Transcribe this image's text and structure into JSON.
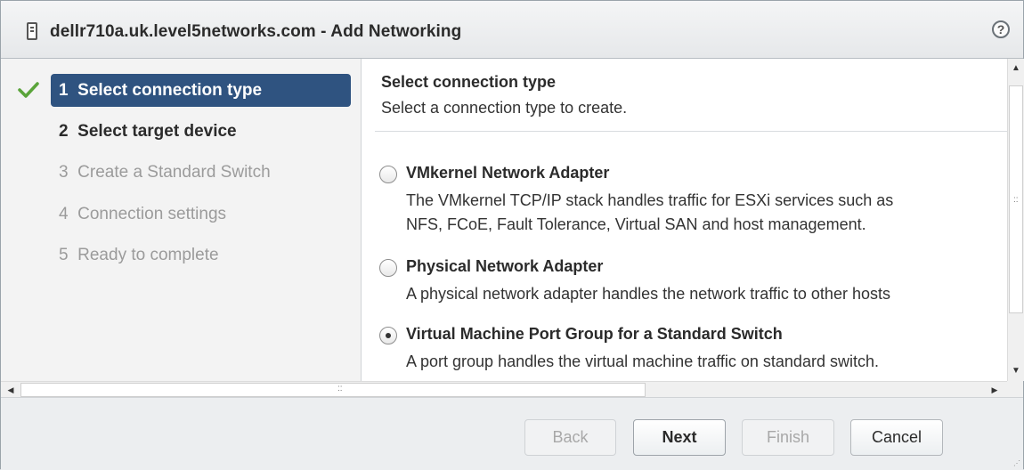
{
  "window": {
    "title": "dellr710a.uk.level5networks.com - Add Networking",
    "help_symbol": "?"
  },
  "wizard": {
    "steps": [
      {
        "number": "1",
        "label": "Select connection type",
        "state": "current",
        "completed": true
      },
      {
        "number": "2",
        "label": "Select target device",
        "state": "next"
      },
      {
        "number": "3",
        "label": "Create a Standard Switch",
        "state": "disabled"
      },
      {
        "number": "4",
        "label": "Connection settings",
        "state": "disabled"
      },
      {
        "number": "5",
        "label": "Ready to complete",
        "state": "disabled"
      }
    ]
  },
  "main": {
    "title": "Select connection type",
    "subtitle": "Select a connection type to create.",
    "options": [
      {
        "label": "VMkernel Network Adapter",
        "description_lines": [
          "The VMkernel TCP/IP stack handles traffic for  ESXi services such as",
          "NFS, FCoE, Fault Tolerance, Virtual SAN and host management."
        ],
        "selected": false
      },
      {
        "label": "Physical Network Adapter",
        "description_lines": [
          "A physical network adapter handles the network traffic to other hosts"
        ],
        "selected": false
      },
      {
        "label": "Virtual Machine Port Group for a Standard Switch",
        "description_lines": [
          "A port group handles the virtual machine traffic on standard switch."
        ],
        "selected": true
      }
    ]
  },
  "footer": {
    "back_label": "Back",
    "next_label": "Next",
    "finish_label": "Finish",
    "cancel_label": "Cancel"
  },
  "icons": {
    "host": "host-server-icon",
    "help": "help-icon",
    "check": "checkmark-icon"
  },
  "colors": {
    "active_step_bg": "#2f5380",
    "check_green": "#5aa43a"
  }
}
